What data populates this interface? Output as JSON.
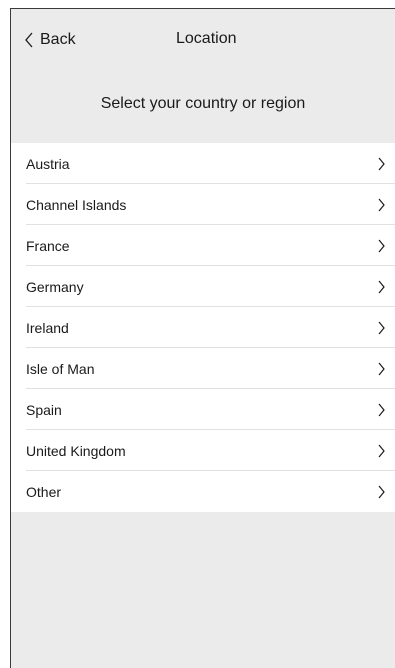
{
  "navbar": {
    "back_label": "Back",
    "back_icon": "chevron-left-icon",
    "title": "Location"
  },
  "section_header": "Select your country or region",
  "countries": [
    {
      "label": "Austria"
    },
    {
      "label": "Channel Islands"
    },
    {
      "label": "France"
    },
    {
      "label": "Germany"
    },
    {
      "label": "Ireland"
    },
    {
      "label": "Isle of Man"
    },
    {
      "label": "Spain"
    },
    {
      "label": "United Kingdom"
    },
    {
      "label": "Other"
    }
  ],
  "row_icon": "chevron-right-icon",
  "colors": {
    "background": "#ebebeb",
    "list_background": "#ffffff",
    "text": "#1a1a1a",
    "separator": "#e1e1e1"
  }
}
